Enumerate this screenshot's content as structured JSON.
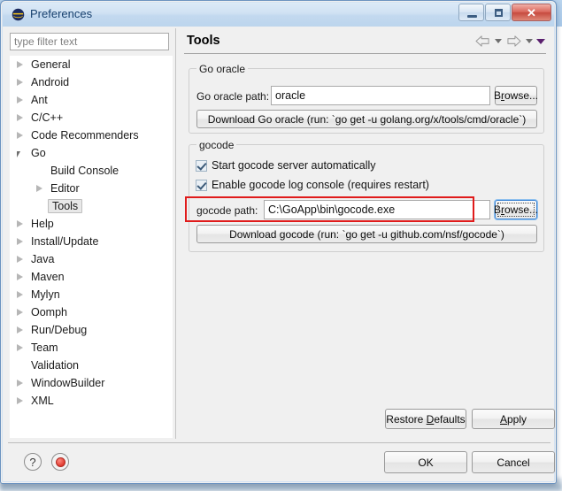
{
  "window": {
    "title": "Preferences",
    "icon": "eclipse-icon",
    "controls": {
      "minimize": "minimize-button",
      "maximize": "maximize-button",
      "close_label": "✕"
    }
  },
  "filter": {
    "placeholder": "type filter text",
    "value": ""
  },
  "tree": [
    {
      "label": "General",
      "indent": 0,
      "state": "collapsed",
      "selected": false
    },
    {
      "label": "Android",
      "indent": 0,
      "state": "collapsed",
      "selected": false
    },
    {
      "label": "Ant",
      "indent": 0,
      "state": "collapsed",
      "selected": false
    },
    {
      "label": "C/C++",
      "indent": 0,
      "state": "collapsed",
      "selected": false
    },
    {
      "label": "Code Recommenders",
      "indent": 0,
      "state": "collapsed",
      "selected": false
    },
    {
      "label": "Go",
      "indent": 0,
      "state": "expanded",
      "selected": false
    },
    {
      "label": "Build Console",
      "indent": 1,
      "state": "leaf",
      "selected": false
    },
    {
      "label": "Editor",
      "indent": 1,
      "state": "collapsed",
      "selected": false
    },
    {
      "label": "Tools",
      "indent": 1,
      "state": "leaf",
      "selected": true
    },
    {
      "label": "Help",
      "indent": 0,
      "state": "collapsed",
      "selected": false
    },
    {
      "label": "Install/Update",
      "indent": 0,
      "state": "collapsed",
      "selected": false
    },
    {
      "label": "Java",
      "indent": 0,
      "state": "collapsed",
      "selected": false
    },
    {
      "label": "Maven",
      "indent": 0,
      "state": "collapsed",
      "selected": false
    },
    {
      "label": "Mylyn",
      "indent": 0,
      "state": "collapsed",
      "selected": false
    },
    {
      "label": "Oomph",
      "indent": 0,
      "state": "collapsed",
      "selected": false
    },
    {
      "label": "Run/Debug",
      "indent": 0,
      "state": "collapsed",
      "selected": false
    },
    {
      "label": "Team",
      "indent": 0,
      "state": "collapsed",
      "selected": false
    },
    {
      "label": "Validation",
      "indent": 0,
      "state": "leaf",
      "selected": false
    },
    {
      "label": "WindowBuilder",
      "indent": 0,
      "state": "collapsed",
      "selected": false
    },
    {
      "label": "XML",
      "indent": 0,
      "state": "collapsed",
      "selected": false
    }
  ],
  "page": {
    "title": "Tools",
    "nav": {
      "back": "back-arrow-icon",
      "back_menu": "back-dropdown-icon",
      "forward": "forward-arrow-icon",
      "forward_menu": "forward-dropdown-icon",
      "view_menu": "view-menu-icon"
    },
    "go_oracle": {
      "group_label": "Go oracle",
      "path_label": "Go oracle path:",
      "path_value": "oracle",
      "browse_label": "Browse...",
      "browse_mnemonic": "r",
      "download_label": "Download Go oracle (run: `go get -u golang.org/x/tools/cmd/oracle`)"
    },
    "gocode": {
      "group_label": "gocode",
      "start_server_label": "Start gocode server automatically",
      "start_server_checked": true,
      "log_console_label": "Enable gocode log console (requires restart)",
      "log_console_checked": true,
      "path_label": "gocode path:",
      "path_value": "C:\\GoApp\\bin\\gocode.exe",
      "browse_label": "Browse...",
      "browse_mnemonic": "r",
      "browse_focused": true,
      "download_label": "Download gocode (run: `go get -u github.com/nsf/gocode`)",
      "highlight_color": "#e01b1b"
    },
    "restore_defaults_label": "Restore Defaults",
    "restore_defaults_mnemonic": "D",
    "apply_label": "Apply",
    "apply_mnemonic": "A"
  },
  "footer": {
    "help_icon": "help-icon",
    "help_glyph": "?",
    "record_icon": "record-icon",
    "ok_label": "OK",
    "cancel_label": "Cancel"
  },
  "colors": {
    "dialog_bg": "#f0f0f0",
    "titlebar": "#cfe1f3",
    "accent_red": "#e01b1b",
    "focus_blue": "#3c84d4"
  }
}
